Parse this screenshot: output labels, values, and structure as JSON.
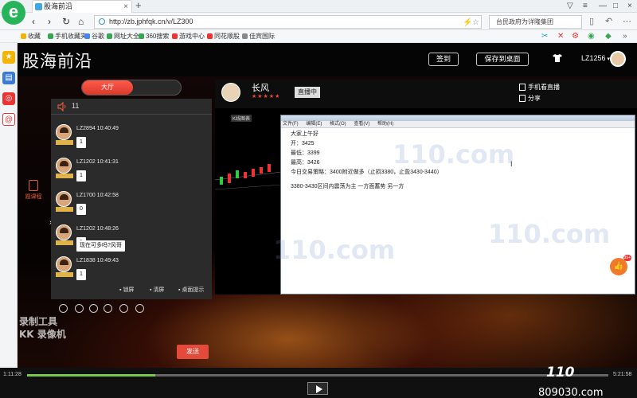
{
  "browser": {
    "logo": "e",
    "tab_title": "股海前沿",
    "new_tab": "+",
    "url": "http://zb.jphfqk.cn/v/LZ300",
    "search_text": "台民政府为详隆集团",
    "bookmarks": [
      "收藏",
      "手机收藏夹",
      "谷歌",
      "网址大全",
      "360搜索",
      "游戏中心",
      "同花顺股",
      "佳宾国际"
    ]
  },
  "header": {
    "site_title": "股海前沿",
    "sign_in": "签到",
    "save_desktop": "保存到桌面",
    "username": "LZ1256"
  },
  "chat": {
    "tab_active": "大厅",
    "online_count": "11",
    "messages": [
      {
        "meta": "LZ2894 10:40:49",
        "text": "1"
      },
      {
        "meta": "LZ1202 10:41:31",
        "text": "1"
      },
      {
        "meta": "LZ1700 10:42:58",
        "text": "0"
      },
      {
        "meta": "LZ1202 10:48:26",
        "text": "1"
      },
      {
        "meta": "LZ1202 10:48:26",
        "text": "现在可多吗?风哥"
      },
      {
        "meta": "LZ1838 10:49:43",
        "text": "1"
      }
    ],
    "footer": {
      "lock": "锁屏",
      "clear": "清屏",
      "desktop_tip": "桌面提示"
    },
    "side_course": "题课程",
    "send": "发送"
  },
  "video": {
    "anchor_name": "长风",
    "stars": "★★★★★",
    "live_badge": "直播中",
    "mobile_watch": "手机看直播",
    "share": "分享",
    "chart_label": "K线图表",
    "notepad_menu": [
      "文件(F)",
      "编辑(E)",
      "格式(O)",
      "查看(V)",
      "帮助(H)"
    ],
    "notepad_lines": [
      "大家上午好",
      "开：3425",
      "最低：3399",
      "最高：3426",
      "今日交易策略：3400附近做多（止损3380，止盈3430-3440）",
      "3380-3430区间内震荡为主  一方面蓄势 另一方"
    ],
    "watermark": "110.com",
    "like_count": "99+"
  },
  "recorder": {
    "line1": "录制工具",
    "line2": "KK 录像机"
  },
  "player": {
    "current_time": "1:11:28",
    "total_time": "5:21:58",
    "progress": 0.22,
    "site_watermark": "809030.com",
    "logo_watermark": "110"
  }
}
